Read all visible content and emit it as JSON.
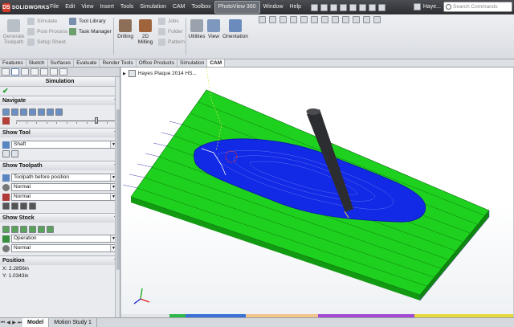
{
  "app": {
    "logo_letters": "DS",
    "brand": "SOLIDWORKS",
    "document_name": "Haye...",
    "search_placeholder": "Search Commands"
  },
  "menus": [
    {
      "label": "File",
      "active": false
    },
    {
      "label": "Edit",
      "active": false
    },
    {
      "label": "View",
      "active": false
    },
    {
      "label": "Insert",
      "active": false
    },
    {
      "label": "Tools",
      "active": false
    },
    {
      "label": "Simulation",
      "active": false
    },
    {
      "label": "CAM",
      "active": false
    },
    {
      "label": "Toolbox",
      "active": false
    },
    {
      "label": "PhotoView 360",
      "active": true
    },
    {
      "label": "Window",
      "active": false
    },
    {
      "label": "Help",
      "active": false
    }
  ],
  "quick_access_icons": [
    "new-icon",
    "open-icon",
    "save-icon",
    "print-icon",
    "undo-icon",
    "select-icon",
    "rebuild-icon",
    "options-icon",
    "help-icon",
    "close-icon"
  ],
  "command_manager": {
    "generate_toolpath": "Generate Toolpath",
    "simulate": "Simulate",
    "post_process": "Post Process",
    "setup_sheet": "Setup Sheet",
    "tool_library": "Tool Library",
    "task_manager": "Task Manager",
    "drilling": "Drilling",
    "milling_2d": "2D Milling",
    "jobs": "Jobs",
    "folder": "Folder",
    "pattern": "Pattern",
    "utilities": "Utilities",
    "view": "View",
    "orientation": "Orientation"
  },
  "tabs": [
    {
      "label": "Features",
      "active": false
    },
    {
      "label": "Sketch",
      "active": false
    },
    {
      "label": "Surfaces",
      "active": false
    },
    {
      "label": "Evaluate",
      "active": false
    },
    {
      "label": "Render Tools",
      "active": false
    },
    {
      "label": "Office Products",
      "active": false
    },
    {
      "label": "Simulation",
      "active": false
    },
    {
      "label": "CAM",
      "active": true
    }
  ],
  "panel": {
    "title": "Simulation",
    "groups": {
      "navigate": {
        "title": "Navigate",
        "slider_value": 0.8
      },
      "show_tool": {
        "title": "Show Tool",
        "tool_value": "Shaft"
      },
      "show_toolpath": {
        "title": "Show Toolpath",
        "toolpath_value": "Toolpath before position",
        "mode1": "Normal",
        "mode2": "Normal"
      },
      "show_stock": {
        "title": "Show Stock",
        "stock_value": "Operation",
        "stock_mode": "Normal"
      },
      "position": {
        "title": "Position",
        "x_value": "X: 2.2856in",
        "y_value": "Y: 1.0343in"
      }
    }
  },
  "viewport": {
    "tree_item": "Hayes Plaque 2014 HS...",
    "colors": {
      "stock_green": "#1fd11f",
      "stock_side": "#139a13",
      "cut_blue": "#1229e6",
      "tool_dark": "#2c2d30"
    }
  },
  "bottom_tabs": [
    {
      "label": "Model",
      "active": true
    },
    {
      "label": "Motion Study 1",
      "active": false
    }
  ]
}
